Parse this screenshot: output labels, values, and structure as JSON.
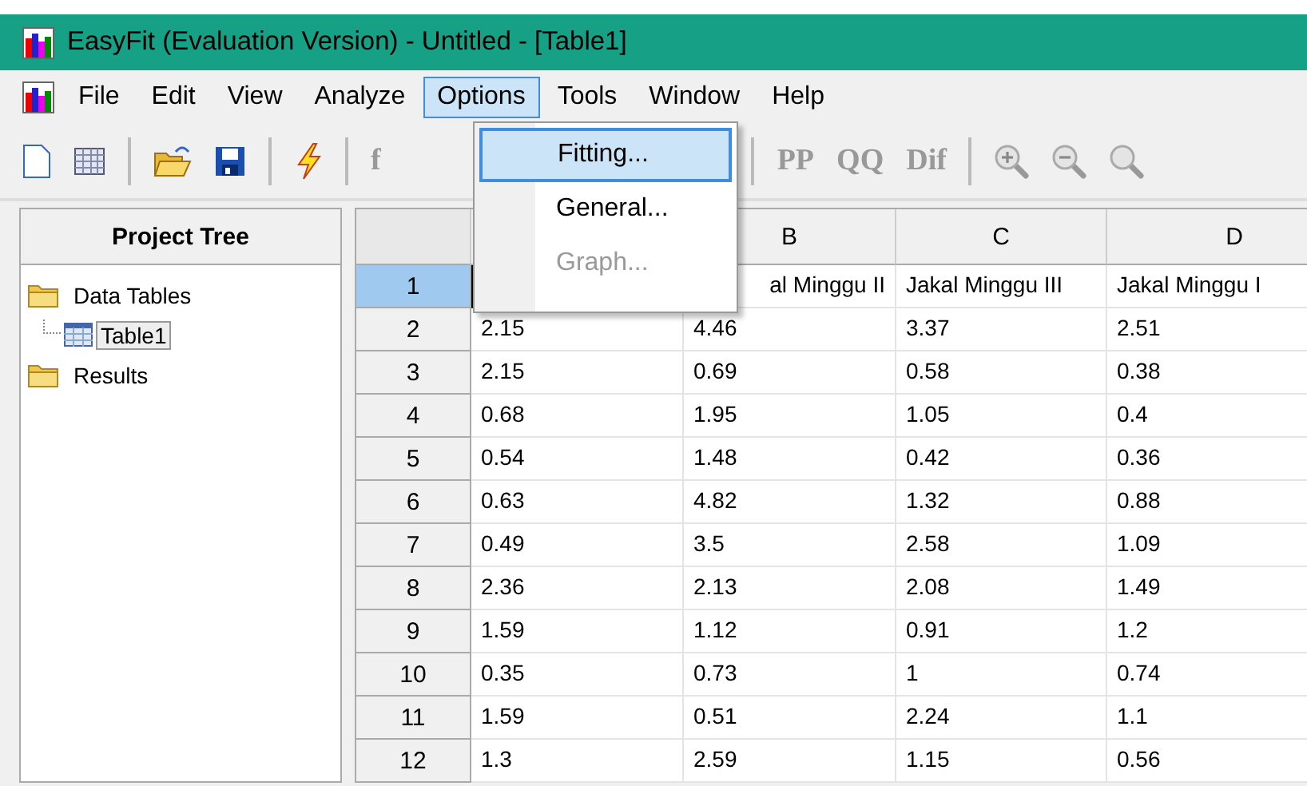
{
  "window": {
    "title": "EasyFit (Evaluation Version) - Untitled - [Table1]"
  },
  "menu_bar": [
    {
      "label": "File",
      "selected": false
    },
    {
      "label": "Edit",
      "selected": false
    },
    {
      "label": "View",
      "selected": false
    },
    {
      "label": "Analyze",
      "selected": false
    },
    {
      "label": "Options",
      "selected": true
    },
    {
      "label": "Tools",
      "selected": false
    },
    {
      "label": "Window",
      "selected": false
    },
    {
      "label": "Help",
      "selected": false
    }
  ],
  "options_menu": [
    {
      "label": "Fitting...",
      "selected": true,
      "disabled": false
    },
    {
      "label": "General...",
      "selected": false,
      "disabled": false
    },
    {
      "label": "Graph...",
      "selected": false,
      "disabled": true
    }
  ],
  "toolbar": {
    "left": [
      {
        "kind": "new"
      },
      {
        "kind": "table"
      },
      {
        "kind": "sep"
      },
      {
        "kind": "open"
      },
      {
        "kind": "save"
      },
      {
        "kind": "sep"
      },
      {
        "kind": "bolt"
      },
      {
        "kind": "sep"
      },
      {
        "kind": "text",
        "label": "f",
        "disabled": true
      }
    ],
    "right": [
      {
        "kind": "sep"
      },
      {
        "kind": "text",
        "label": "PP",
        "disabled": true
      },
      {
        "kind": "text",
        "label": "QQ",
        "disabled": true
      },
      {
        "kind": "text",
        "label": "Dif",
        "disabled": true
      },
      {
        "kind": "sep"
      },
      {
        "kind": "zoom-in"
      },
      {
        "kind": "zoom-out"
      },
      {
        "kind": "zoom"
      }
    ]
  },
  "project_tree": {
    "title": "Project Tree",
    "items": [
      {
        "label": "Data Tables",
        "kind": "folder",
        "selected": false,
        "children": [
          {
            "label": "Table1",
            "kind": "table",
            "selected": true
          }
        ]
      },
      {
        "label": "Results",
        "kind": "folder",
        "selected": false
      }
    ]
  },
  "table": {
    "columns": [
      null,
      "B",
      "C",
      "D"
    ],
    "rows": [
      {
        "header": "1",
        "selected": true,
        "cells": [
          null,
          "al Minggu II",
          "Jakal Minggu III",
          "Jakal Minggu I"
        ]
      },
      {
        "header": "2",
        "selected": false,
        "cells": [
          "2.15",
          "4.46",
          "3.37",
          "2.51"
        ]
      },
      {
        "header": "3",
        "selected": false,
        "cells": [
          "2.15",
          "0.69",
          "0.58",
          "0.38"
        ]
      },
      {
        "header": "4",
        "selected": false,
        "cells": [
          "0.68",
          "1.95",
          "1.05",
          "0.4"
        ]
      },
      {
        "header": "5",
        "selected": false,
        "cells": [
          "0.54",
          "1.48",
          "0.42",
          "0.36"
        ]
      },
      {
        "header": "6",
        "selected": false,
        "cells": [
          "0.63",
          "4.82",
          "1.32",
          "0.88"
        ]
      },
      {
        "header": "7",
        "selected": false,
        "cells": [
          "0.49",
          "3.5",
          "2.58",
          "1.09"
        ]
      },
      {
        "header": "8",
        "selected": false,
        "cells": [
          "2.36",
          "2.13",
          "2.08",
          "1.49"
        ]
      },
      {
        "header": "9",
        "selected": false,
        "cells": [
          "1.59",
          "1.12",
          "0.91",
          "1.2"
        ]
      },
      {
        "header": "10",
        "selected": false,
        "cells": [
          "0.35",
          "0.73",
          "1",
          "0.74"
        ]
      },
      {
        "header": "11",
        "selected": false,
        "cells": [
          "1.59",
          "0.51",
          "2.24",
          "1.1"
        ]
      },
      {
        "header": "12",
        "selected": false,
        "cells": [
          "1.3",
          "2.59",
          "1.15",
          "0.56"
        ]
      }
    ]
  }
}
